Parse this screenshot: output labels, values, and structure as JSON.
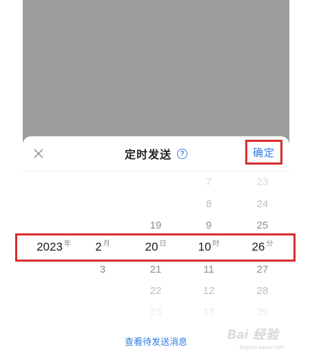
{
  "sheet": {
    "title": "定时发送",
    "help_icon": "help-circle-icon",
    "close_icon": "close-icon",
    "confirm_label": "确定"
  },
  "picker": {
    "year": {
      "above": [],
      "selected": "2023",
      "unit": "年",
      "below": []
    },
    "month": {
      "above": [],
      "selected": "2",
      "unit": "月",
      "below": [
        "3"
      ]
    },
    "day": {
      "above": [
        "19"
      ],
      "selected": "20",
      "unit": "日",
      "below": [
        "21",
        "22",
        "23"
      ]
    },
    "hour": {
      "above": [
        "7",
        "8",
        "9"
      ],
      "selected": "10",
      "unit": "时",
      "below": [
        "11",
        "12",
        "13"
      ]
    },
    "minute": {
      "above": [
        "23",
        "24",
        "25"
      ],
      "selected": "26",
      "unit": "分",
      "below": [
        "27",
        "28",
        "29"
      ]
    }
  },
  "footer": {
    "link": "查看待发送消息"
  },
  "watermark": {
    "text": "Bai 经验",
    "sub": "jingyan.baidu.com"
  },
  "colors": {
    "accent": "#2f7be5",
    "highlight_border": "#d92c2c",
    "overlay": "#9c9c9c"
  }
}
